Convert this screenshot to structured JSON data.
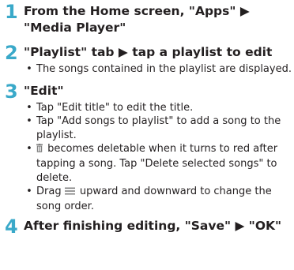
{
  "steps": [
    {
      "number": "1",
      "title": "From the Home screen, \"Apps\" ▶\n\"Media Player\"",
      "bullets": []
    },
    {
      "number": "2",
      "title": "\"Playlist\" tab ▶ tap a playlist to edit",
      "bullets": [
        "The songs contained in the playlist are displayed."
      ]
    },
    {
      "number": "3",
      "title": "\"Edit\"",
      "bullets": [
        "Tap \"Edit title\" to edit the title.",
        "Tap \"Add songs to playlist\" to add a song to the playlist.",
        "becomes deletable when it turns to red after tapping a song. Tap \"Delete selected songs\" to delete.",
        "Drag",
        "upward and downward to change the song order."
      ]
    },
    {
      "number": "4",
      "title": "After finishing editing, \"Save\" ▶ \"OK\"",
      "bullets": []
    }
  ],
  "bullet_marker": "•",
  "icons": {
    "trash": "trash-icon",
    "drag": "drag-handle-icon"
  },
  "colors": {
    "step_number": "#3aa9c9",
    "text": "#231f20",
    "icon_gray": "#808080"
  }
}
